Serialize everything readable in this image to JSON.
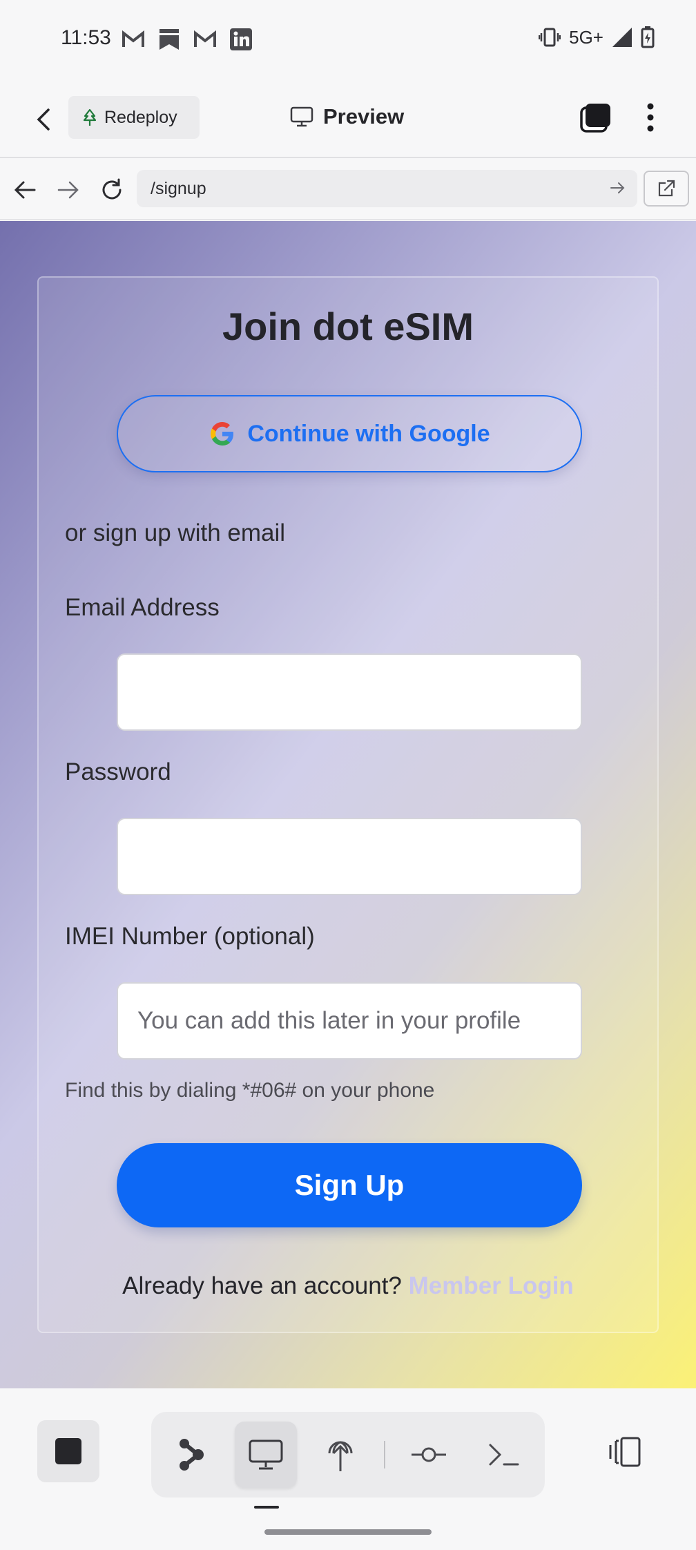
{
  "status_bar": {
    "time": "11:53",
    "notifications": [
      "gmail-icon",
      "bookmark-icon",
      "gmail-icon",
      "linkedin-icon"
    ],
    "network": "5G+"
  },
  "app_bar": {
    "redeploy_label": "Redeploy",
    "preview_label": "Preview"
  },
  "browser": {
    "url": "/signup"
  },
  "signup": {
    "title": "Join dot eSIM",
    "google_button": "Continue with Google",
    "or_text": "or sign up with email",
    "email_label": "Email Address",
    "email_value": "",
    "password_label": "Password",
    "password_value": "",
    "imei_label": "IMEI Number (optional)",
    "imei_placeholder": "You can add this later in your profile",
    "imei_hint": "Find this by dialing *#06# on your phone",
    "submit_label": "Sign Up",
    "login_prompt": "Already have an account?",
    "login_link": "Member Login"
  },
  "colors": {
    "accent": "#0d68f5",
    "link_faded": "#c9c6ee"
  },
  "bottom_toolbar": {
    "tools": [
      "agent-icon",
      "monitor-icon",
      "deploy-icon",
      "commit-icon",
      "terminal-icon"
    ],
    "active": "monitor-icon"
  }
}
